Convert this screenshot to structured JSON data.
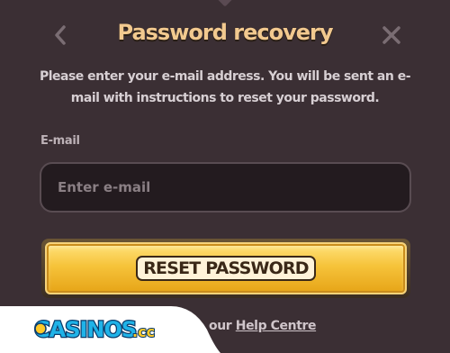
{
  "header": {
    "title": "Password recovery",
    "back_icon": "chevron-left-icon",
    "close_icon": "close-icon"
  },
  "description": "Please enter your e-mail address. You will be sent an e-mail with instructions to reset your password.",
  "form": {
    "email_label": "E-mail",
    "email_placeholder": "Enter e-mail",
    "email_value": ""
  },
  "reset_button": {
    "label": "RESET PASSWORD"
  },
  "footer": {
    "partial_text": "our ",
    "help_link": "Help Centre"
  },
  "watermark": {
    "text": "CASINOS.cc"
  },
  "colors": {
    "background": "#3b2f34",
    "title": "#f2c98f",
    "button_gold": "#f6c33a",
    "input_bg": "#231b1f"
  }
}
